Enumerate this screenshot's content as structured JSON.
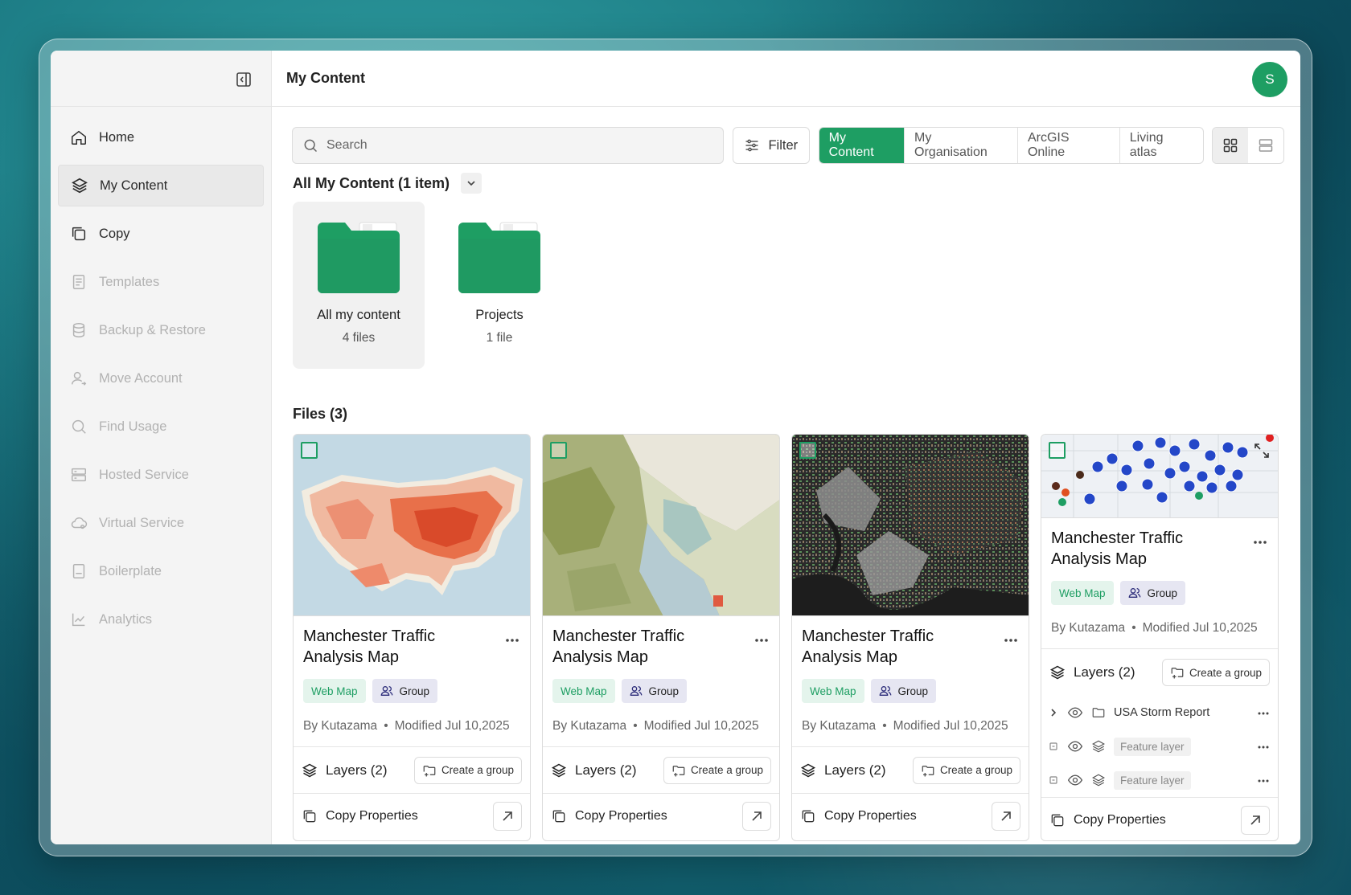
{
  "header": {
    "title": "My Content",
    "avatar_initial": "S"
  },
  "sidebar": {
    "items": [
      {
        "label": "Home",
        "icon": "home-icon",
        "state": "normal"
      },
      {
        "label": "My Content",
        "icon": "layers-icon",
        "state": "active"
      },
      {
        "label": "Copy",
        "icon": "copy-icon",
        "state": "normal"
      },
      {
        "label": "Templates",
        "icon": "document-icon",
        "state": "disabled"
      },
      {
        "label": "Backup & Restore",
        "icon": "database-icon",
        "state": "disabled"
      },
      {
        "label": "Move Account",
        "icon": "user-move-icon",
        "state": "disabled"
      },
      {
        "label": "Find Usage",
        "icon": "search-icon",
        "state": "disabled"
      },
      {
        "label": "Hosted Service",
        "icon": "server-icon",
        "state": "disabled"
      },
      {
        "label": "Virtual Service",
        "icon": "cloud-icon",
        "state": "disabled"
      },
      {
        "label": "Boilerplate",
        "icon": "page-icon",
        "state": "disabled"
      },
      {
        "label": "Analytics",
        "icon": "analytics-icon",
        "state": "disabled"
      }
    ]
  },
  "toolbar": {
    "search_placeholder": "Search",
    "filter_label": "Filter",
    "scopes": [
      "My Content",
      "My Organisation",
      "ArcGIS Online",
      "Living atlas"
    ],
    "active_scope": "My Content",
    "view_mode": "grid"
  },
  "content": {
    "section_title": "All My Content (1 item)",
    "folders": [
      {
        "name": "All my content",
        "count": "4 files",
        "selected": true
      },
      {
        "name": "Projects",
        "count": "1 file",
        "selected": false
      }
    ],
    "files_title": "Files (3)"
  },
  "cards": [
    {
      "title": "Manchester Traffic Analysis Map",
      "tag_type": "Web Map",
      "tag_group": "Group",
      "author": "By Kutazama",
      "modified": "Modified Jul 10,2025",
      "layers": "Layers (2)",
      "create_group": "Create a group",
      "copy": "Copy Properties",
      "thumb": "usa-choropleth"
    },
    {
      "title": "Manchester Traffic Analysis Map",
      "tag_type": "Web Map",
      "tag_group": "Group",
      "author": "By Kutazama",
      "modified": "Modified Jul 10,2025",
      "layers": "Layers (2)",
      "create_group": "Create a group",
      "copy": "Copy Properties",
      "thumb": "terrain-map"
    },
    {
      "title": "Manchester Traffic Analysis Map",
      "tag_type": "Web Map",
      "tag_group": "Group",
      "author": "By Kutazama",
      "modified": "Modified Jul 10,2025",
      "layers": "Layers (2)",
      "create_group": "Create a group",
      "copy": "Copy Properties",
      "thumb": "city-parcels"
    },
    {
      "title": "Manchester Traffic Analysis Map",
      "tag_type": "Web Map",
      "tag_group": "Group",
      "author": "By Kutazama",
      "modified": "Modified Jul 10,2025",
      "layers": "Layers (2)",
      "create_group": "Create a group",
      "copy": "Copy Properties",
      "thumb": "parking-points",
      "tree": [
        {
          "label": "USA Storm Report",
          "kind": "folder"
        },
        {
          "label": "Feature layer",
          "kind": "layer"
        },
        {
          "label": "Feature layer",
          "kind": "layer"
        }
      ]
    }
  ],
  "colors": {
    "accent": "#1e9e63",
    "tag_web_bg": "#e4f4ec",
    "tag_group_bg": "#e6e6f2"
  }
}
